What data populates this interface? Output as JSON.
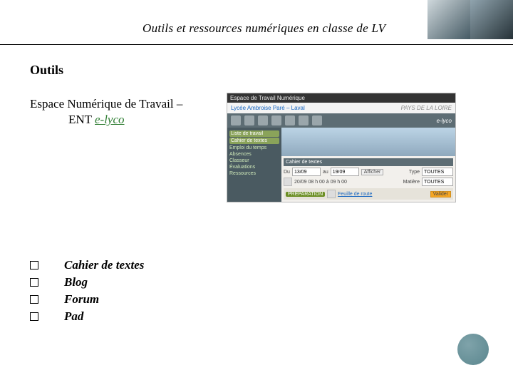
{
  "header": {
    "title_italic": "Outils et ressources numériques en classe de LV"
  },
  "section": {
    "heading": "Outils"
  },
  "subtitle": {
    "line1": "Espace Numérique de Travail –",
    "line2_prefix": "ENT ",
    "link_text": "e-lyco"
  },
  "items": [
    {
      "label": "Cahier de textes",
      "bold": true
    },
    {
      "label": "Blog",
      "bold": true
    },
    {
      "label": "Forum",
      "bold": true
    },
    {
      "label": "Pad",
      "bold": true
    }
  ],
  "screenshot": {
    "window_title": "Espace de Travail Numérique",
    "banner_school": "Lycée Ambroise Paré – Laval",
    "banner_region": "PAYS DE LA LOIRE",
    "brand": "e-lyco",
    "sidebar": [
      "Liste de travail",
      "Cahier de textes",
      "Emploi du temps",
      "Absences",
      "Classeur",
      "Évaluations",
      "Ressources"
    ],
    "panel_title": "Cahier de textes",
    "filter": {
      "label": "Du",
      "date1": "13/09",
      "to": "au",
      "date2": "19/09",
      "refresh": "Afficher"
    },
    "fields": {
      "f1_label": "Type",
      "f1_val": "TOUTES",
      "f2_label": "Matière",
      "f2_val": "TOUTES"
    },
    "date_line": "20/09 08 h 00 à 09 h 00",
    "task_label": "PRÉPARATION",
    "task_link": "Feuille de route",
    "ok": "Valider"
  }
}
